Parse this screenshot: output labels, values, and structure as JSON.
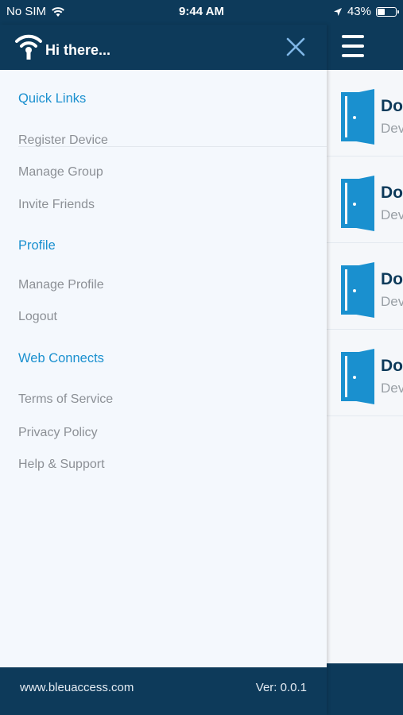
{
  "status_bar": {
    "carrier": "No SIM",
    "time": "9:44 AM",
    "battery_percent": "43%",
    "battery_level": 0.43
  },
  "drawer": {
    "greeting": "Hi there...",
    "sections": [
      {
        "title": "Quick Links",
        "items": [
          "Register Device",
          "Manage Group",
          "Invite Friends"
        ]
      },
      {
        "title": "Profile",
        "items": [
          "Manage Profile",
          "Logout"
        ]
      },
      {
        "title": "Web Connects",
        "items": [
          "Terms of Service",
          "Privacy Policy",
          "Help & Support"
        ]
      }
    ],
    "footer": {
      "website": "www.bleuaccess.com",
      "version": "Ver: 0.0.1"
    }
  },
  "main": {
    "devices": [
      {
        "name": "Do",
        "subtitle": "Dev"
      },
      {
        "name": "Do",
        "subtitle": "Dev"
      },
      {
        "name": "Do",
        "subtitle": "Dev"
      },
      {
        "name": "Do",
        "subtitle": "Dev"
      }
    ]
  },
  "colors": {
    "navy": "#0d3a5a",
    "accent_blue": "#1a90cf",
    "menu_gray": "#8c9096",
    "drawer_bg": "#f4f8fd"
  }
}
